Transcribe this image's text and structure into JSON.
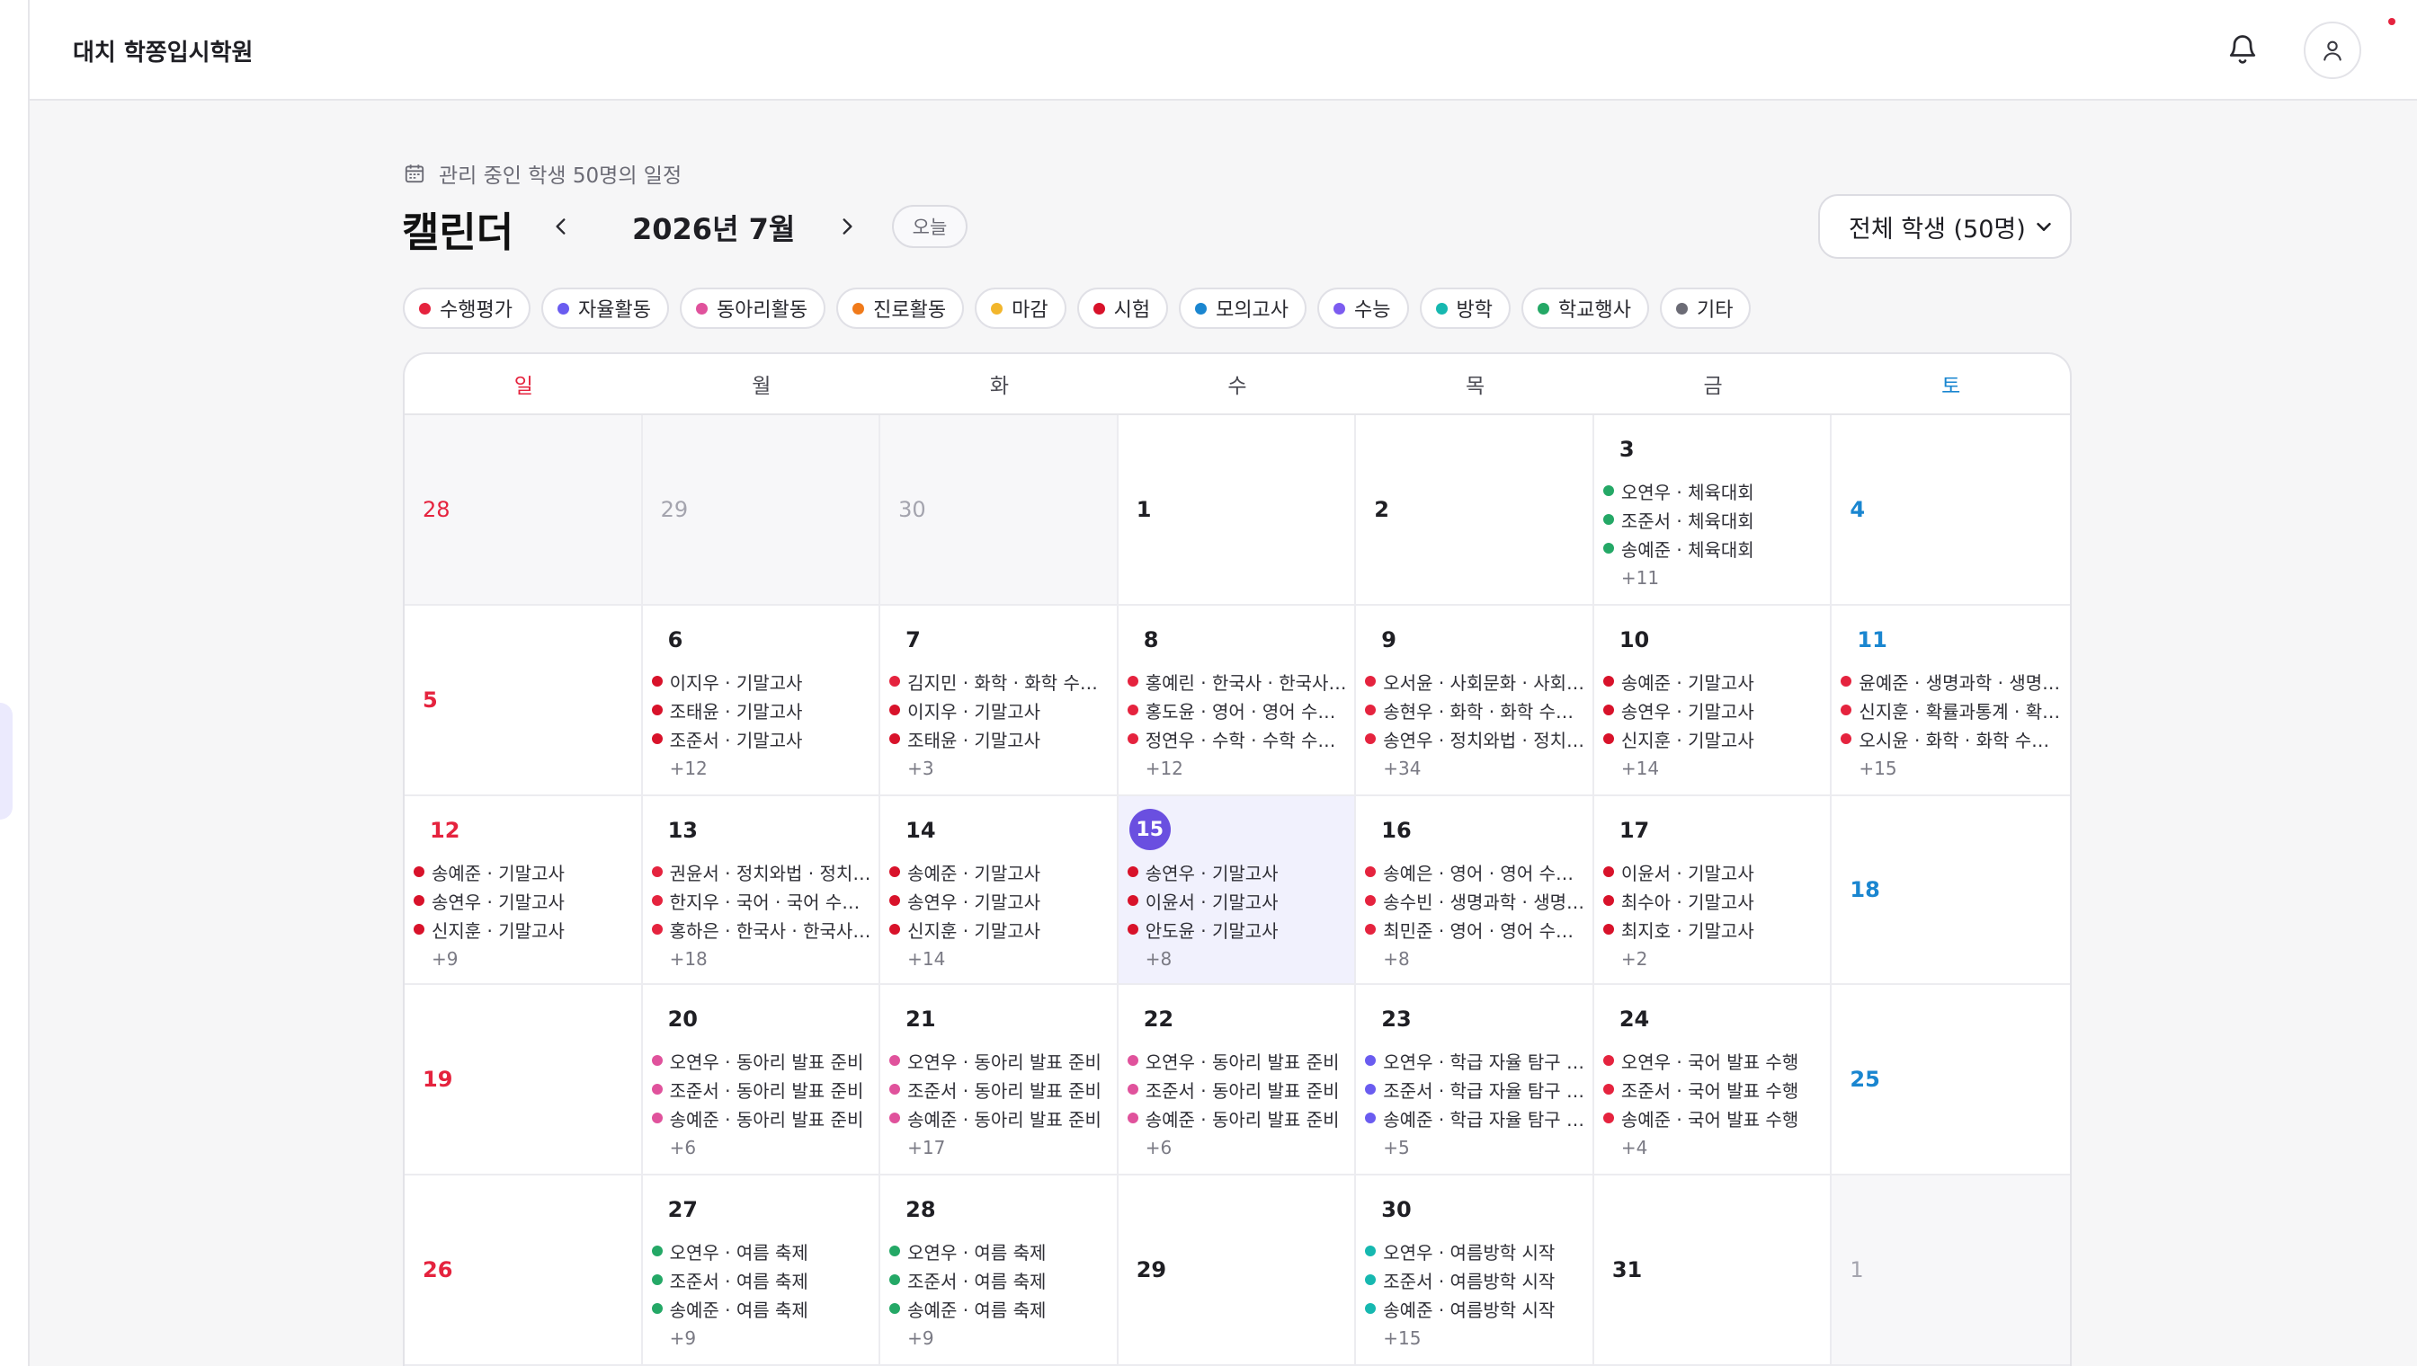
{
  "app": {
    "title": "대치 학쫑입시학원"
  },
  "header": {
    "subtitle": "관리 중인 학생 50명의 일정",
    "title": "캘린더",
    "month": "2026년 7월",
    "today_label": "오늘"
  },
  "filter": {
    "selected": "전체 학생 (50명)"
  },
  "categories": [
    {
      "label": "수행평가",
      "color": "#e5233e"
    },
    {
      "label": "자율활동",
      "color": "#6a5cf0"
    },
    {
      "label": "동아리활동",
      "color": "#e0529c"
    },
    {
      "label": "진로활동",
      "color": "#f07a1a"
    },
    {
      "label": "마감",
      "color": "#f2b62c"
    },
    {
      "label": "시험",
      "color": "#d8122a"
    },
    {
      "label": "모의고사",
      "color": "#1a86d0"
    },
    {
      "label": "수능",
      "color": "#7c5cf0"
    },
    {
      "label": "방학",
      "color": "#16b8b0"
    },
    {
      "label": "학교행사",
      "color": "#24a866"
    },
    {
      "label": "기타",
      "color": "#6b6b75"
    }
  ],
  "weekdays": [
    "일",
    "월",
    "화",
    "수",
    "목",
    "금",
    "토"
  ],
  "calendar": {
    "days": [
      {
        "day": "28",
        "other": true,
        "events": []
      },
      {
        "day": "29",
        "other": true,
        "events": []
      },
      {
        "day": "30",
        "other": true,
        "events": []
      },
      {
        "day": "1",
        "events": []
      },
      {
        "day": "2",
        "events": []
      },
      {
        "day": "3",
        "events": [
          {
            "text": "오연우 · 체육대회",
            "color": "#24a866"
          },
          {
            "text": "조준서 · 체육대회",
            "color": "#24a866"
          },
          {
            "text": "송예준 · 체육대회",
            "color": "#24a866"
          }
        ],
        "more": "+11"
      },
      {
        "day": "4",
        "events": []
      },
      {
        "day": "5",
        "events": []
      },
      {
        "day": "6",
        "events": [
          {
            "text": "이지우 · 기말고사",
            "color": "#d8122a"
          },
          {
            "text": "조태윤 · 기말고사",
            "color": "#d8122a"
          },
          {
            "text": "조준서 · 기말고사",
            "color": "#d8122a"
          }
        ],
        "more": "+12"
      },
      {
        "day": "7",
        "events": [
          {
            "text": "김지민 · 화학 · 화학 수행평가",
            "color": "#e5233e"
          },
          {
            "text": "이지우 · 기말고사",
            "color": "#d8122a"
          },
          {
            "text": "조태윤 · 기말고사",
            "color": "#d8122a"
          }
        ],
        "more": "+3"
      },
      {
        "day": "8",
        "events": [
          {
            "text": "홍예린 · 한국사 · 한국사 수행평가",
            "color": "#e5233e"
          },
          {
            "text": "홍도윤 · 영어 · 영어 수행평가",
            "color": "#e5233e"
          },
          {
            "text": "정연우 · 수학 · 수학 수행평가",
            "color": "#e5233e"
          }
        ],
        "more": "+12"
      },
      {
        "day": "9",
        "events": [
          {
            "text": "오서윤 · 사회문화 · 사회문화 수행평가",
            "color": "#e5233e"
          },
          {
            "text": "송현우 · 화학 · 화학 수행평가",
            "color": "#e5233e"
          },
          {
            "text": "송연우 · 정치와법 · 정치와법 수행평가",
            "color": "#e5233e"
          }
        ],
        "more": "+34"
      },
      {
        "day": "10",
        "events": [
          {
            "text": "송예준 · 기말고사",
            "color": "#d8122a"
          },
          {
            "text": "송연우 · 기말고사",
            "color": "#d8122a"
          },
          {
            "text": "신지훈 · 기말고사",
            "color": "#d8122a"
          }
        ],
        "more": "+14"
      },
      {
        "day": "11",
        "events": [
          {
            "text": "윤예준 · 생명과학 · 생명과학 수행평가",
            "color": "#e5233e"
          },
          {
            "text": "신지훈 · 확률과통계 · 확률과통계 수행평가",
            "color": "#e5233e"
          },
          {
            "text": "오시윤 · 화학 · 화학 수행평가",
            "color": "#e5233e"
          }
        ],
        "more": "+15"
      },
      {
        "day": "12",
        "events": [
          {
            "text": "송예준 · 기말고사",
            "color": "#d8122a"
          },
          {
            "text": "송연우 · 기말고사",
            "color": "#d8122a"
          },
          {
            "text": "신지훈 · 기말고사",
            "color": "#d8122a"
          }
        ],
        "more": "+9"
      },
      {
        "day": "13",
        "events": [
          {
            "text": "권윤서 · 정치와법 · 정치와법 수행평가",
            "color": "#e5233e"
          },
          {
            "text": "한지우 · 국어 · 국어 수행평가",
            "color": "#e5233e"
          },
          {
            "text": "홍하은 · 한국사 · 한국사 수행평가",
            "color": "#e5233e"
          }
        ],
        "more": "+18"
      },
      {
        "day": "14",
        "events": [
          {
            "text": "송예준 · 기말고사",
            "color": "#d8122a"
          },
          {
            "text": "송연우 · 기말고사",
            "color": "#d8122a"
          },
          {
            "text": "신지훈 · 기말고사",
            "color": "#d8122a"
          }
        ],
        "more": "+14"
      },
      {
        "day": "15",
        "today": true,
        "events": [
          {
            "text": "송연우 · 기말고사",
            "color": "#d8122a"
          },
          {
            "text": "이윤서 · 기말고사",
            "color": "#d8122a"
          },
          {
            "text": "안도윤 · 기말고사",
            "color": "#d8122a"
          }
        ],
        "more": "+8"
      },
      {
        "day": "16",
        "events": [
          {
            "text": "송예은 · 영어 · 영어 수행평가",
            "color": "#e5233e"
          },
          {
            "text": "송수빈 · 생명과학 · 생명과학 수행평가",
            "color": "#e5233e"
          },
          {
            "text": "최민준 · 영어 · 영어 수행평가",
            "color": "#e5233e"
          }
        ],
        "more": "+8"
      },
      {
        "day": "17",
        "events": [
          {
            "text": "이윤서 · 기말고사",
            "color": "#d8122a"
          },
          {
            "text": "최수아 · 기말고사",
            "color": "#d8122a"
          },
          {
            "text": "최지호 · 기말고사",
            "color": "#d8122a"
          }
        ],
        "more": "+2"
      },
      {
        "day": "18",
        "events": []
      },
      {
        "day": "19",
        "events": []
      },
      {
        "day": "20",
        "events": [
          {
            "text": "오연우 · 동아리 발표 준비",
            "color": "#e0529c"
          },
          {
            "text": "조준서 · 동아리 발표 준비",
            "color": "#e0529c"
          },
          {
            "text": "송예준 · 동아리 발표 준비",
            "color": "#e0529c"
          }
        ],
        "more": "+6"
      },
      {
        "day": "21",
        "events": [
          {
            "text": "오연우 · 동아리 발표 준비",
            "color": "#e0529c"
          },
          {
            "text": "조준서 · 동아리 발표 준비",
            "color": "#e0529c"
          },
          {
            "text": "송예준 · 동아리 발표 준비",
            "color": "#e0529c"
          }
        ],
        "more": "+17"
      },
      {
        "day": "22",
        "events": [
          {
            "text": "오연우 · 동아리 발표 준비",
            "color": "#e0529c"
          },
          {
            "text": "조준서 · 동아리 발표 준비",
            "color": "#e0529c"
          },
          {
            "text": "송예준 · 동아리 발표 준비",
            "color": "#e0529c"
          }
        ],
        "more": "+6"
      },
      {
        "day": "23",
        "events": [
          {
            "text": "오연우 · 학급 자율 탐구 발표",
            "color": "#6a5cf0"
          },
          {
            "text": "조준서 · 학급 자율 탐구 발표",
            "color": "#6a5cf0"
          },
          {
            "text": "송예준 · 학급 자율 탐구 발표",
            "color": "#6a5cf0"
          }
        ],
        "more": "+5"
      },
      {
        "day": "24",
        "events": [
          {
            "text": "오연우 · 국어 발표 수행",
            "color": "#e5233e"
          },
          {
            "text": "조준서 · 국어 발표 수행",
            "color": "#e5233e"
          },
          {
            "text": "송예준 · 국어 발표 수행",
            "color": "#e5233e"
          }
        ],
        "more": "+4"
      },
      {
        "day": "25",
        "events": []
      },
      {
        "day": "26",
        "events": []
      },
      {
        "day": "27",
        "events": [
          {
            "text": "오연우 · 여름 축제",
            "color": "#24a866"
          },
          {
            "text": "조준서 · 여름 축제",
            "color": "#24a866"
          },
          {
            "text": "송예준 · 여름 축제",
            "color": "#24a866"
          }
        ],
        "more": "+9"
      },
      {
        "day": "28",
        "events": [
          {
            "text": "오연우 · 여름 축제",
            "color": "#24a866"
          },
          {
            "text": "조준서 · 여름 축제",
            "color": "#24a866"
          },
          {
            "text": "송예준 · 여름 축제",
            "color": "#24a866"
          }
        ],
        "more": "+9"
      },
      {
        "day": "29",
        "events": []
      },
      {
        "day": "30",
        "events": [
          {
            "text": "오연우 · 여름방학 시작",
            "color": "#16b8b0"
          },
          {
            "text": "조준서 · 여름방학 시작",
            "color": "#16b8b0"
          },
          {
            "text": "송예준 · 여름방학 시작",
            "color": "#16b8b0"
          }
        ],
        "more": "+15"
      },
      {
        "day": "31",
        "events": []
      },
      {
        "day": "1",
        "other": true,
        "events": []
      }
    ]
  }
}
